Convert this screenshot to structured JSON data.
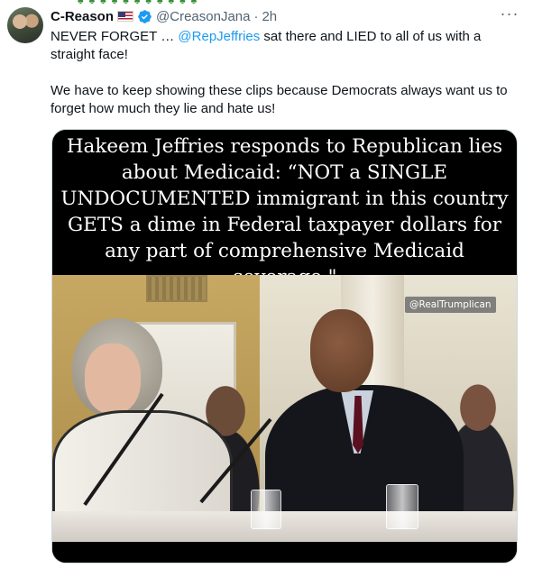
{
  "tweet": {
    "author": {
      "display_name": "C-Reason",
      "flag_icon": "us-flag-icon",
      "verified_icon": "verified-badge-icon",
      "handle": "@CreasonJana",
      "separator": "·",
      "timestamp": "2h"
    },
    "more_icon": "more-options-icon",
    "text": {
      "line1_prefix": "NEVER FORGET … ",
      "mention": "@RepJeffries",
      "line1_suffix": " sat there and LIED to all of us with a straight face!",
      "paragraph2": "We have to keep showing these clips because Democrats always want us to forget how much they lie and hate us!"
    },
    "media": {
      "caption": "Hakeem Jeffries responds to Republican lies about Medicaid: “NOT a SINGLE UNDOCUMENTED immigrant in this country GETS a dime in Federal taxpayer dollars for any part of comprehensive Medicaid coverage.\"",
      "watermark": "@RealTrumplican"
    }
  },
  "colors": {
    "link": "#1d9bf0",
    "secondary_text": "#536471",
    "verified": "#1d9bf0"
  }
}
